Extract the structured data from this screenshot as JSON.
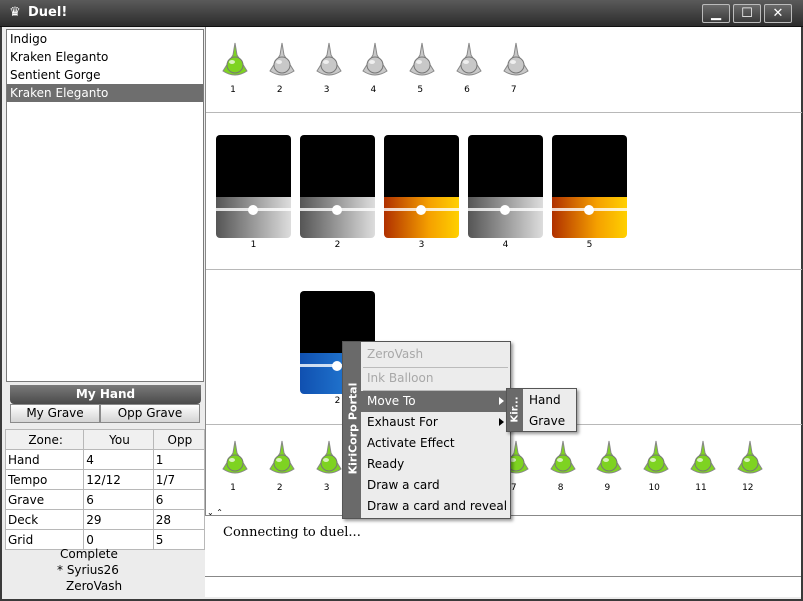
{
  "window": {
    "title": "Duel!",
    "minimize": "▭",
    "maximize": "☐",
    "close": "✕"
  },
  "card_list": {
    "items": [
      "Indigo",
      "Kraken Eleganto",
      "Sentient Gorge",
      "Kraken Eleganto"
    ],
    "selected_index": 3
  },
  "tabs": {
    "my_hand": "My Hand",
    "my_grave": "My Grave",
    "opp_grave": "Opp Grave"
  },
  "zone_table": {
    "headers": [
      "Zone:",
      "You",
      "Opp"
    ],
    "rows": [
      [
        "Hand",
        "4",
        "1"
      ],
      [
        "Tempo",
        "12/12",
        "1/7"
      ],
      [
        "Grave",
        "6",
        "6"
      ],
      [
        "Deck",
        "29",
        "28"
      ],
      [
        "Grid",
        "0",
        "5"
      ]
    ]
  },
  "status_lines": [
    "Complete",
    "* Syrius26",
    "ZeroVash"
  ],
  "opp_tempo_slots": {
    "labels": [
      "1",
      "2",
      "3",
      "4",
      "5",
      "6",
      "7"
    ],
    "active_count": 1
  },
  "opp_cards": {
    "labels": [
      "1",
      "2",
      "3",
      "4",
      "5"
    ],
    "colors": [
      "gray",
      "gray",
      "orange",
      "gray",
      "orange"
    ]
  },
  "my_cards": {
    "labels": [
      "2"
    ],
    "colors": [
      "blue"
    ]
  },
  "my_tempo_slots": {
    "labels": [
      "1",
      "2",
      "3",
      "4",
      "5",
      "6",
      "7",
      "8",
      "9",
      "10",
      "11",
      "12"
    ]
  },
  "log_text": "Connecting to duel...",
  "context_menu": {
    "side_label": "KiriCorp Portal",
    "items": [
      "ZeroVash",
      "Ink Balloon",
      "Move To",
      "Exhaust For",
      "Activate Effect",
      "Ready",
      "Draw a card",
      "Draw a card and reveal"
    ]
  },
  "submenu": {
    "side_label": "Kir...",
    "items": [
      "Hand",
      "Grave"
    ]
  },
  "colors": {
    "green": "#7ed321",
    "gray_slot": "#c8c8c8",
    "orange": "#f5a000",
    "blue": "#1a6fd0",
    "menu_highlight": "#6a6a6a"
  }
}
